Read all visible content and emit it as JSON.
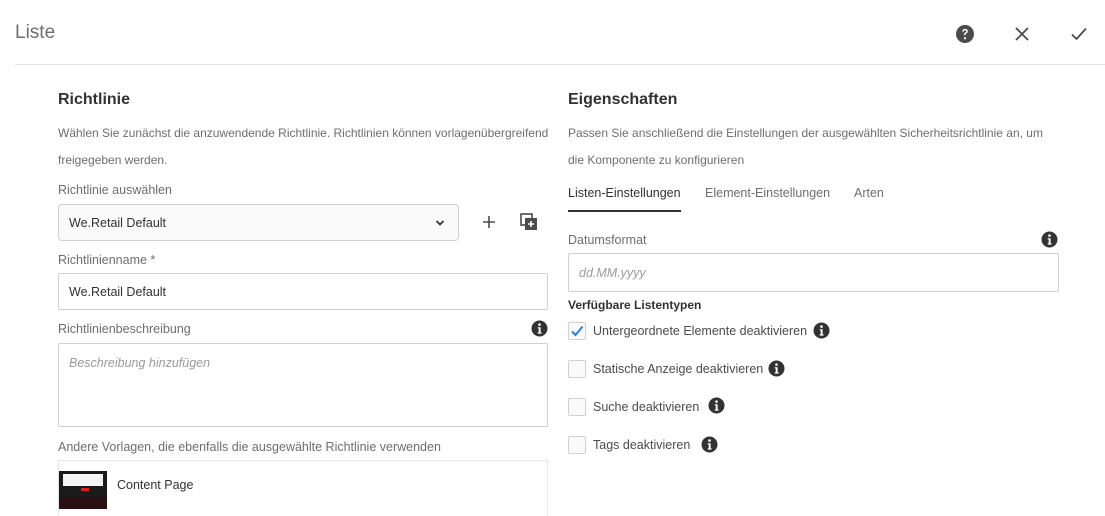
{
  "header": {
    "title": "Liste"
  },
  "left": {
    "heading": "Richtlinie",
    "description": "Wählen Sie zunächst die anzuwendende Richtlinie. Richtlinien können vorlagenübergreifend freigegeben werden.",
    "select_label": "Richtlinie auswählen",
    "select_value": "We.Retail Default",
    "name_label": "Richtlinienname *",
    "name_value": "We.Retail Default",
    "desc_label": "Richtlinienbeschreibung",
    "desc_placeholder": "Beschreibung hinzufügen",
    "templates_label": "Andere Vorlagen, die ebenfalls die ausgewählte Richtlinie verwenden",
    "templates": [
      {
        "name": "Content Page"
      }
    ]
  },
  "right": {
    "heading": "Eigenschaften",
    "description": "Passen Sie anschließend die Einstellungen der ausgewählten Sicherheitsrichtlinie an, um die Komponente zu konfigurieren",
    "tabs": [
      {
        "label": "Listen-Einstellungen",
        "active": true
      },
      {
        "label": "Element-Einstellungen",
        "active": false
      },
      {
        "label": "Arten",
        "active": false
      }
    ],
    "date_label": "Datumsformat",
    "date_placeholder": "dd.MM.yyyy",
    "types_label": "Verfügbare Listentypen",
    "checkboxes": [
      {
        "label": "Untergeordnete Elemente deaktivieren",
        "checked": true
      },
      {
        "label": "Statische Anzeige deaktivieren",
        "checked": false
      },
      {
        "label": "Suche deaktivieren",
        "checked": false
      },
      {
        "label": "Tags deaktivieren",
        "checked": false
      }
    ]
  },
  "colors": {
    "accent": "#2680eb",
    "text": "#4b4b4b",
    "border": "#d0d0d0"
  }
}
